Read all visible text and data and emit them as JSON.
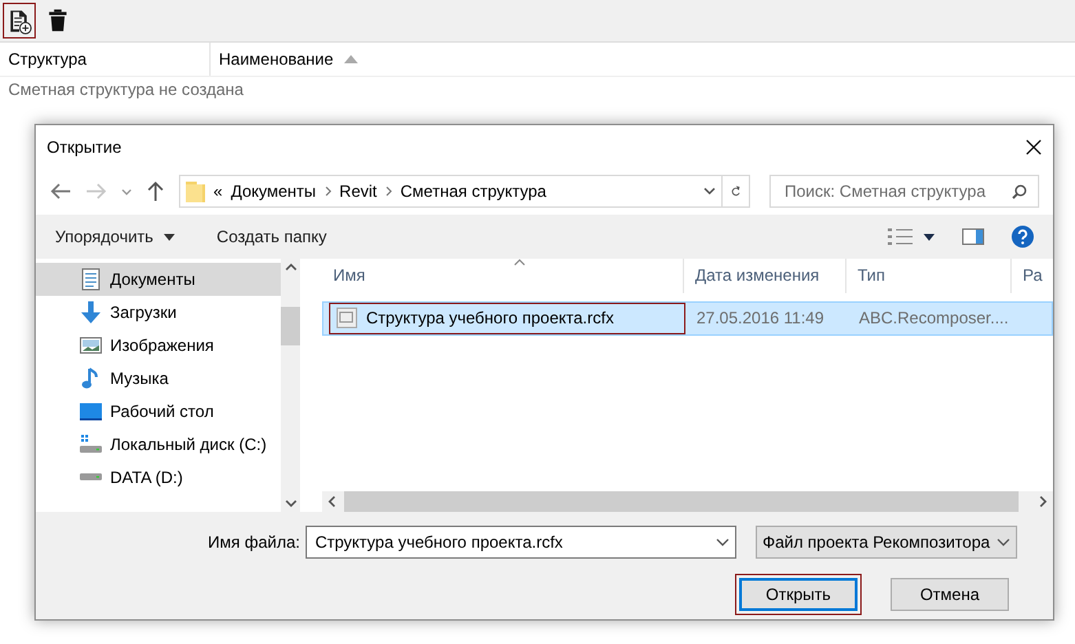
{
  "app": {
    "toolbar": [
      {
        "kind": "new",
        "highlighted": true
      },
      {
        "kind": "delete",
        "highlighted": false
      }
    ],
    "table": {
      "columns": [
        {
          "label": "Структура",
          "sorted": false
        },
        {
          "label": "Наименование",
          "sorted": true
        }
      ],
      "empty_text": "Сметная структура не создана"
    }
  },
  "dialog": {
    "title": "Открытие",
    "address": {
      "overflow": "«",
      "crumbs": [
        "Документы",
        "Revit",
        "Сметная структура"
      ]
    },
    "search": {
      "placeholder": "Поиск: Сметная структура"
    },
    "commands": [
      {
        "label": "Упорядочить",
        "dropdown": true
      },
      {
        "label": "Создать папку",
        "dropdown": false
      }
    ],
    "sidebar": {
      "items": [
        {
          "label": "Документы",
          "kind": "documents",
          "selected": true
        },
        {
          "label": "Загрузки",
          "kind": "downloads",
          "selected": false
        },
        {
          "label": "Изображения",
          "kind": "pictures",
          "selected": false
        },
        {
          "label": "Музыка",
          "kind": "music",
          "selected": false
        },
        {
          "label": "Рабочий стол",
          "kind": "desktop",
          "selected": false
        },
        {
          "label": "Локальный диск (C:)",
          "kind": "system-drive",
          "selected": false
        },
        {
          "label": "DATA (D:)",
          "kind": "drive",
          "selected": false
        }
      ]
    },
    "files": {
      "columns": [
        {
          "label": "Имя",
          "sorted": true
        },
        {
          "label": "Дата изменения",
          "sorted": false
        },
        {
          "label": "Тип",
          "sorted": false
        },
        {
          "label": "Ра",
          "sorted": false
        }
      ],
      "rows": [
        {
          "name": "Структура учебного проекта.rcfx",
          "date": "27.05.2016 11:49",
          "type": "ABC.Recomposer....",
          "selected": true,
          "highlighted": true
        }
      ]
    },
    "footer": {
      "filename_label": "Имя файла:",
      "filename": "Структура учебного проекта.rcfx",
      "filetype": "Файл проекта Рекомпозитора",
      "buttons": [
        {
          "label": "Открыть",
          "default": true,
          "highlighted": true
        },
        {
          "label": "Отмена",
          "default": false,
          "highlighted": false
        }
      ]
    }
  }
}
